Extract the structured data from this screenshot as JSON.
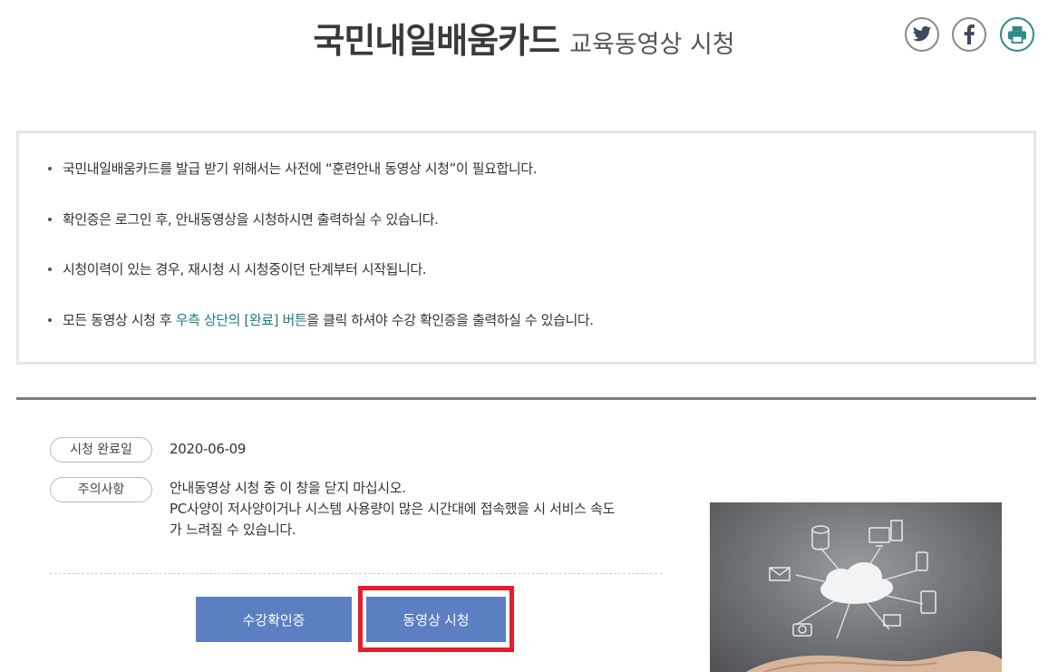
{
  "header": {
    "title_main": "국민내일배움카드",
    "title_sub": "교육동영상 시청",
    "share_icons": [
      "twitter-icon",
      "facebook-icon",
      "print-icon"
    ]
  },
  "notice": {
    "items": [
      {
        "text": "국민내일배움카드를 발급 받기 위해서는 사전에 “훈련안내 동영상 시청”이 필요합니다."
      },
      {
        "text": "확인증은 로그인 후, 안내동영상을 시청하시면 출력하실 수 있습니다."
      },
      {
        "text": "시청이력이 있는 경우, 재시청 시 시청중이던 단계부터 시작됩니다."
      },
      {
        "pre": "모든 동영상 시청 후 ",
        "highlight": "우측 상단의 [완료] 버튼",
        "post": "을 클릭 하셔야 수강 확인증을 출력하실 수 있습니다."
      }
    ]
  },
  "details": {
    "completion_label": "시청 완료일",
    "completion_date": "2020-06-09",
    "caution_label": "주의사항",
    "caution_line1": "안내동영상 시청 중 이 창을 닫지 마십시오.",
    "caution_line2": "PC사양이 저사양이거나 시스템 사용량이 많은 시간대에 접속했을 시 서비스 속도",
    "caution_line3": "가 느려질 수 있습니다."
  },
  "buttons": {
    "certificate": "수강확인증",
    "watch_video": "동영상 시청"
  },
  "colors": {
    "accent_button": "#5b7fc1",
    "highlight_text": "#1e7b7b",
    "highlight_box": "#e61d2b"
  }
}
